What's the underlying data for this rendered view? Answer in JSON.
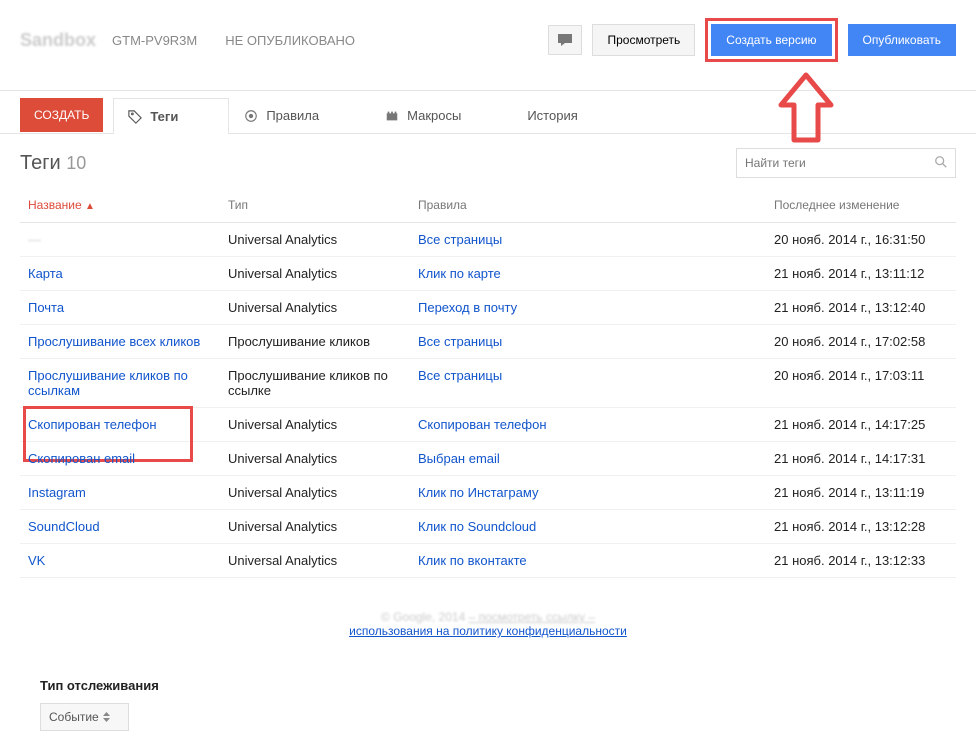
{
  "header": {
    "logo_text": "Sandbox",
    "gtm_id": "GTM-PV9R3M",
    "pub_status": "НЕ ОПУБЛИКОВАНО",
    "preview_label": "Просмотреть",
    "create_version_label": "Создать версию",
    "publish_label": "Опубликовать"
  },
  "tabs": {
    "create_label": "СОЗДАТЬ",
    "tags_label": "Теги",
    "rules_label": "Правила",
    "macros_label": "Макросы",
    "history_label": "История"
  },
  "page": {
    "title": "Теги",
    "count": "10",
    "search_placeholder": "Найти теги"
  },
  "columns": {
    "name": "Название",
    "type": "Тип",
    "rules": "Правила",
    "last_modified": "Последнее изменение"
  },
  "rows": [
    {
      "name": "—",
      "type": "Universal Analytics",
      "rule": "Все страницы",
      "date": "20 нояб. 2014 г., 16:31:50",
      "name_blur": true
    },
    {
      "name": "Карта",
      "type": "Universal Analytics",
      "rule": "Клик по карте",
      "date": "21 нояб. 2014 г., 13:11:12"
    },
    {
      "name": "Почта",
      "type": "Universal Analytics",
      "rule": "Переход в почту",
      "date": "21 нояб. 2014 г., 13:12:40"
    },
    {
      "name": "Прослушивание всех кликов",
      "type": "Прослушивание кликов",
      "rule": "Все страницы",
      "date": "20 нояб. 2014 г., 17:02:58"
    },
    {
      "name": "Прослушивание кликов по ссылкам",
      "type": "Прослушивание кликов по ссылке",
      "rule": "Все страницы",
      "date": "20 нояб. 2014 г., 17:03:11"
    },
    {
      "name": "Скопирован телефон",
      "type": "Universal Analytics",
      "rule": "Скопирован телефон",
      "date": "21 нояб. 2014 г., 14:17:25"
    },
    {
      "name": "Скопирован email",
      "type": "Universal Analytics",
      "rule": "Выбран email",
      "date": "21 нояб. 2014 г., 14:17:31"
    },
    {
      "name": "Instagram",
      "type": "Universal Analytics",
      "rule": "Клик по Инстаграму",
      "date": "21 нояб. 2014 г., 13:11:19"
    },
    {
      "name": "SoundCloud",
      "type": "Universal Analytics",
      "rule": "Клик по Soundcloud",
      "date": "21 нояб. 2014 г., 13:12:28"
    },
    {
      "name": "VK",
      "type": "Universal Analytics",
      "rule": "Клик по вконтакте",
      "date": "21 нояб. 2014 г., 13:12:33"
    }
  ],
  "footer": {
    "copyright": "© Google, 2014",
    "link1": "– посмотреть ссылку –",
    "link2": "использования на политику конфиденциальности"
  },
  "bottom": {
    "label": "Тип отслеживания",
    "select_value": "Событие"
  }
}
